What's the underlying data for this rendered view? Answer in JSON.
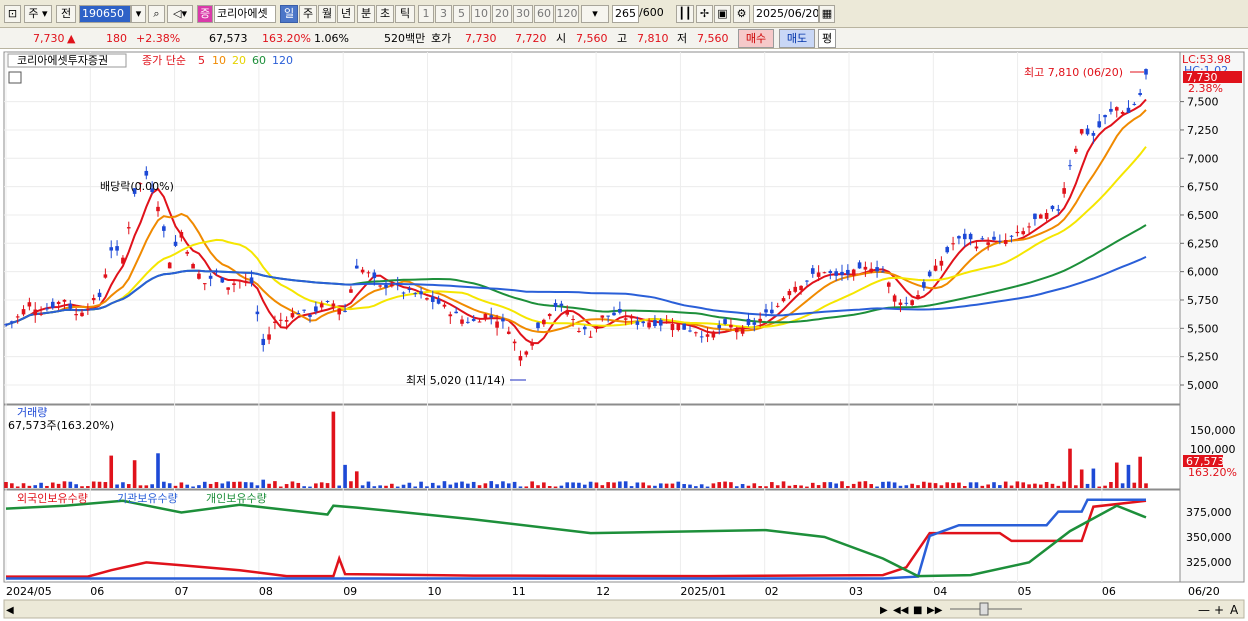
{
  "toolbar": {
    "period_type": "주",
    "prev_label": "전",
    "stock_code": "190650",
    "badge": "증",
    "stock_name": "코리아에셋",
    "periods": [
      "일",
      "주",
      "월",
      "년",
      "분",
      "초",
      "틱"
    ],
    "active_period": "일",
    "intervals": [
      "1",
      "3",
      "5",
      "10",
      "20",
      "30",
      "60",
      "120"
    ],
    "count": "265",
    "count_total": "/600",
    "date": "2025/06/20"
  },
  "quote": {
    "price": "7,730",
    "change_arrow": "▲",
    "change": "180",
    "change_pct": "+2.38%",
    "volume": "67,573",
    "volume_ratio": "163.20%",
    "turnover": "1.06%",
    "amount": "520백만",
    "hoga_label": "호가",
    "ask": "7,730",
    "bid": "7,720",
    "open_label": "시",
    "open": "7,560",
    "high_label": "고",
    "high": "7,810",
    "low_label": "저",
    "low": "7,560",
    "buy_btn": "매수",
    "sell_btn": "매도",
    "eval_btn": "평"
  },
  "chart_data": [
    {
      "type": "candlestick",
      "title": "코리아에셋투자증권",
      "ma_label": "종가 단순",
      "ma_periods": [
        "5",
        "10",
        "20",
        "60",
        "120"
      ],
      "ma_colors": [
        "#e0121b",
        "#f08a00",
        "#f5e600",
        "#1d8f3a",
        "#2a5fd8"
      ],
      "ylim": [
        4850,
        7920
      ],
      "yticks": [
        "5,000",
        "5,250",
        "5,500",
        "5,750",
        "6,000",
        "6,250",
        "6,500",
        "6,750",
        "7,000",
        "7,250",
        "7,500"
      ],
      "x_labels": [
        "2024/05",
        "06",
        "07",
        "08",
        "09",
        "10",
        "11",
        "12",
        "2025/01",
        "02",
        "03",
        "04",
        "05",
        "06"
      ],
      "last_date_label": "06/20",
      "dates_month_index": [
        0,
        1,
        2,
        3,
        4,
        5,
        6,
        7,
        8,
        9,
        10,
        11,
        12,
        13
      ],
      "lc_label": "LC:53.98",
      "hc_label": "HC:1.02",
      "price_tag": "7,730",
      "pct_tag": "2.38%",
      "annotations": {
        "high": "최고 7,810 (06/20)",
        "low": "최저 5,020 (11/14)",
        "dividend": "배당락(0.00%)"
      },
      "price_path": [
        [
          0,
          5530
        ],
        [
          2,
          5600
        ],
        [
          4,
          5720
        ],
        [
          6,
          5650
        ],
        [
          8,
          5700
        ],
        [
          10,
          5760
        ],
        [
          12,
          5620
        ],
        [
          14,
          5700
        ],
        [
          16,
          5780
        ],
        [
          18,
          6200
        ],
        [
          20,
          6120
        ],
        [
          22,
          6700
        ],
        [
          24,
          6850
        ],
        [
          26,
          6600
        ],
        [
          28,
          6100
        ],
        [
          30,
          6350
        ],
        [
          32,
          6050
        ],
        [
          34,
          5900
        ],
        [
          36,
          5980
        ],
        [
          38,
          5880
        ],
        [
          40,
          5920
        ],
        [
          42,
          5900
        ],
        [
          44,
          5350
        ],
        [
          46,
          5550
        ],
        [
          48,
          5600
        ],
        [
          50,
          5650
        ],
        [
          52,
          5620
        ],
        [
          54,
          5700
        ],
        [
          56,
          5720
        ],
        [
          58,
          5650
        ],
        [
          60,
          6050
        ],
        [
          62,
          5980
        ],
        [
          64,
          5860
        ],
        [
          66,
          5900
        ],
        [
          68,
          5820
        ],
        [
          70,
          5800
        ],
        [
          72,
          5760
        ],
        [
          74,
          5720
        ],
        [
          76,
          5650
        ],
        [
          78,
          5580
        ],
        [
          80,
          5560
        ],
        [
          82,
          5620
        ],
        [
          84,
          5580
        ],
        [
          86,
          5500
        ],
        [
          88,
          5250
        ],
        [
          90,
          5400
        ],
        [
          92,
          5600
        ],
        [
          94,
          5700
        ],
        [
          96,
          5650
        ],
        [
          98,
          5500
        ],
        [
          100,
          5450
        ],
        [
          102,
          5600
        ],
        [
          104,
          5620
        ],
        [
          106,
          5600
        ],
        [
          108,
          5550
        ],
        [
          110,
          5560
        ],
        [
          112,
          5540
        ],
        [
          114,
          5560
        ],
        [
          116,
          5500
        ],
        [
          118,
          5480
        ],
        [
          120,
          5420
        ],
        [
          122,
          5500
        ],
        [
          124,
          5520
        ],
        [
          126,
          5480
        ],
        [
          128,
          5540
        ],
        [
          130,
          5620
        ],
        [
          132,
          5700
        ],
        [
          134,
          5850
        ],
        [
          136,
          5900
        ],
        [
          138,
          5960
        ],
        [
          140,
          6010
        ],
        [
          142,
          5950
        ],
        [
          144,
          5980
        ],
        [
          146,
          6000
        ],
        [
          148,
          6050
        ],
        [
          150,
          6000
        ],
        [
          152,
          5780
        ],
        [
          154,
          5720
        ],
        [
          156,
          5800
        ],
        [
          158,
          5950
        ],
        [
          160,
          6100
        ],
        [
          162,
          6250
        ],
        [
          164,
          6300
        ],
        [
          166,
          6250
        ],
        [
          168,
          6280
        ],
        [
          170,
          6250
        ],
        [
          172,
          6300
        ],
        [
          174,
          6350
        ],
        [
          176,
          6450
        ],
        [
          178,
          6500
        ],
        [
          180,
          6550
        ],
        [
          182,
          6950
        ],
        [
          184,
          7250
        ],
        [
          186,
          7200
        ],
        [
          188,
          7350
        ],
        [
          190,
          7450
        ],
        [
          192,
          7400
        ],
        [
          194,
          7560
        ],
        [
          195,
          7730
        ]
      ],
      "volume_axis": [
        "150,000",
        "100,000"
      ],
      "volume_label": "거래량",
      "volume_readout": "67,573주(163.20%)",
      "volume_tag": "67,573",
      "volume_pct_tag": "163.20%",
      "volume_spikes": [
        [
          18,
          70000
        ],
        [
          22,
          60000
        ],
        [
          26,
          75000
        ],
        [
          44,
          18000
        ],
        [
          56,
          165000
        ],
        [
          58,
          50000
        ],
        [
          60,
          36000
        ],
        [
          182,
          85000
        ],
        [
          184,
          40000
        ],
        [
          186,
          42000
        ],
        [
          190,
          55000
        ],
        [
          192,
          50000
        ],
        [
          194,
          67573
        ]
      ],
      "holdings_axis": [
        "375,000",
        "350,000",
        "325,000"
      ],
      "holdings_legend": [
        "외국인보유수량",
        "기관보유수량",
        "개인보유수량"
      ],
      "holdings_colors": [
        "#e0121b",
        "#2a5fd8",
        "#1d8f3a"
      ]
    }
  ],
  "footer": {
    "nav_buttons": [
      "▶",
      "◀◀",
      "■",
      "▶▶"
    ],
    "tools": [
      "—",
      "+",
      "A"
    ]
  }
}
